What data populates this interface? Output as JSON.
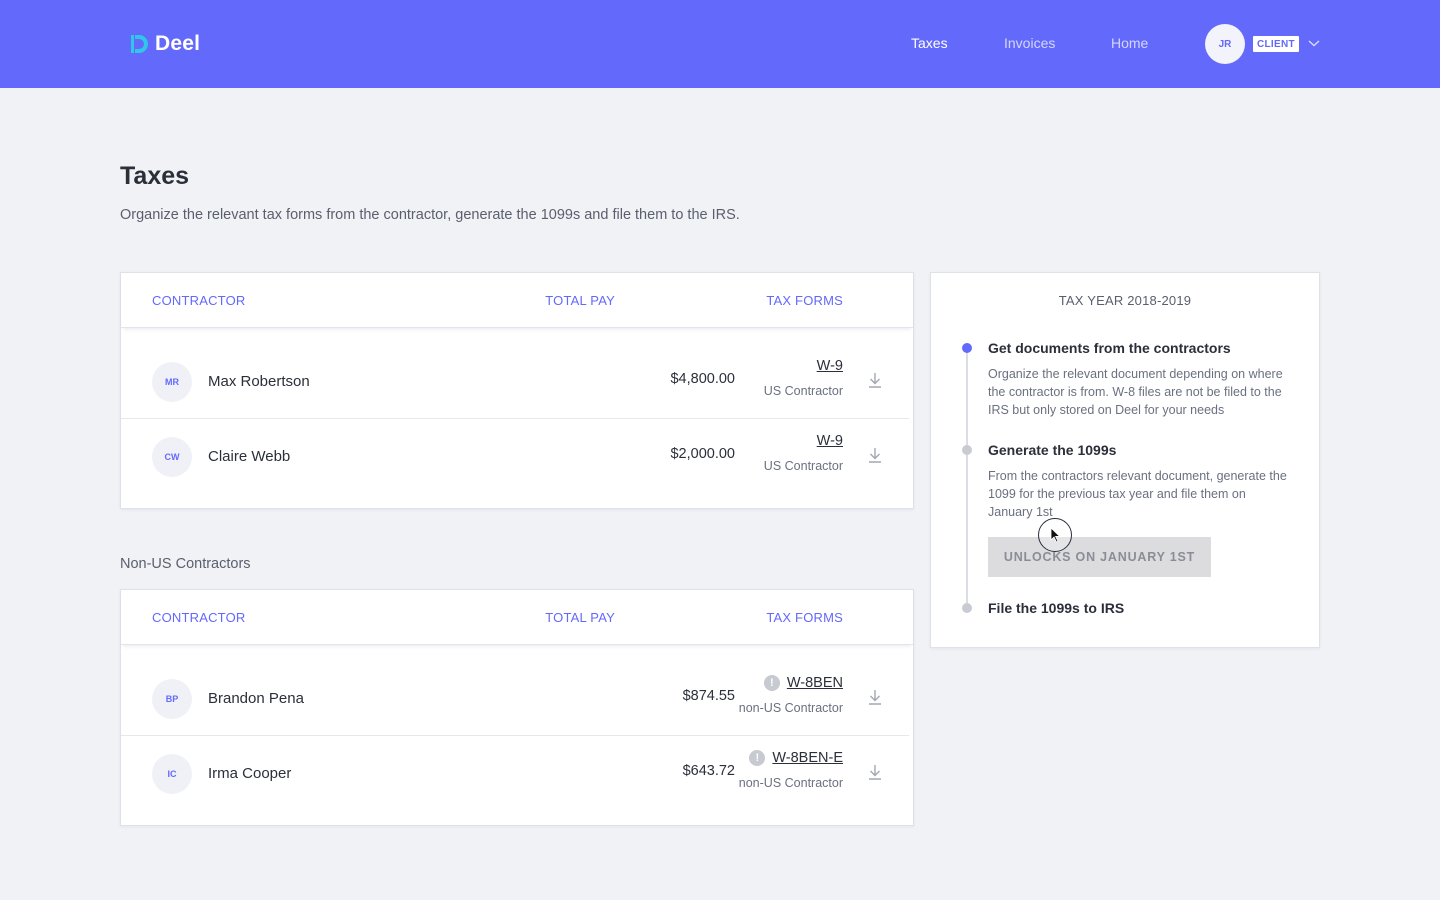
{
  "header": {
    "logo_text": "Deel",
    "nav": [
      {
        "label": "Taxes",
        "active": true
      },
      {
        "label": "Invoices",
        "active": false
      },
      {
        "label": "Home",
        "active": false
      }
    ],
    "user_initials": "JR",
    "role_badge": "CLIENT",
    "brand_color": "#6369fb"
  },
  "page": {
    "title": "Taxes",
    "subtitle": "Organize the relevant tax forms from the contractor, generate the 1099s and file them to the IRS."
  },
  "us_table": {
    "columns": [
      "CONTRACTOR",
      "TOTAL PAY",
      "TAX FORMS"
    ],
    "rows": [
      {
        "initials": "MR",
        "name": "Max Robertson",
        "pay": "$4,800.00",
        "form": "W-9",
        "type": "US Contractor"
      },
      {
        "initials": "CW",
        "name": "Claire Webb",
        "pay": "$2,000.00",
        "form": "W-9",
        "type": "US Contractor"
      }
    ]
  },
  "non_us_section_label": "Non-US Contractors",
  "non_us_table": {
    "columns": [
      "CONTRACTOR",
      "TOTAL PAY",
      "TAX FORMS"
    ],
    "rows": [
      {
        "initials": "BP",
        "name": "Brandon Pena",
        "pay": "$874.55",
        "form": "W-8BEN",
        "type": "non-US Contractor",
        "warning": "!"
      },
      {
        "initials": "IC",
        "name": "Irma Cooper",
        "pay": "$643.72",
        "form": "W-8BEN-E",
        "type": "non-US Contractor",
        "warning": "!"
      }
    ]
  },
  "tax_year": {
    "title": "TAX YEAR 2018-2019",
    "steps": [
      {
        "title": "Get documents from the contractors",
        "desc": "Organize the relevant document depending on where the contractor is from. W-8 files are not be filed to the IRS but only stored on Deel for your needs",
        "active": true
      },
      {
        "title": "Generate the 1099s",
        "desc": "From the contractors relevant document, generate the 1099 for the previous tax year and file them on January 1st",
        "active": false
      },
      {
        "title": "File the 1099s to IRS",
        "desc": "",
        "active": false
      }
    ],
    "unlock_button": "UNLOCKS ON JANUARY 1ST"
  }
}
